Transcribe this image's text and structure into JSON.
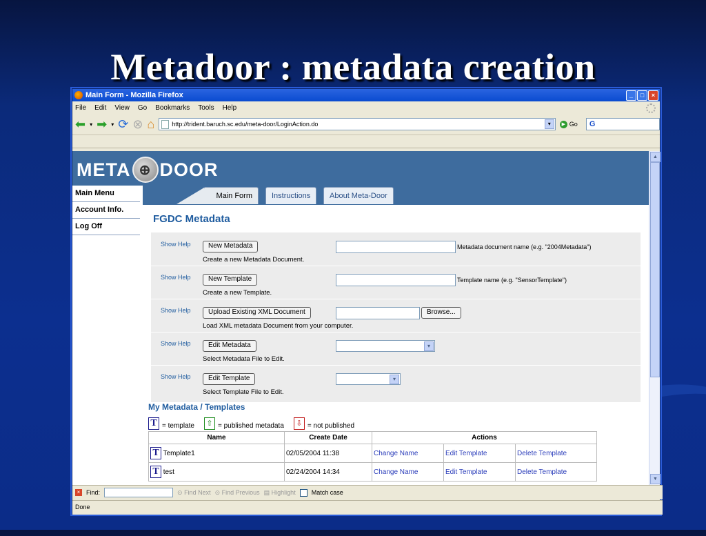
{
  "slide": {
    "title": "Metadoor : metadata creation"
  },
  "window": {
    "title": "Main Form - Mozilla Firefox"
  },
  "menu": [
    "File",
    "Edit",
    "View",
    "Go",
    "Bookmarks",
    "Tools",
    "Help"
  ],
  "toolbar": {
    "url": "http://trident.baruch.sc.edu/meta-door/LoginAction.do",
    "go_label": "Go",
    "search_logo": "G"
  },
  "header": {
    "logo_left": "META",
    "logo_right": "DOOR"
  },
  "sidebar": {
    "items": [
      "Main Menu",
      "Account Info.",
      "Log Off"
    ]
  },
  "tabs": [
    "Main Form",
    "Instructions",
    "About Meta-Door"
  ],
  "form": {
    "title": "FGDC Metadata",
    "show_help": "Show Help",
    "rows": [
      {
        "button": "New Metadata",
        "desc": "Create a new Metadata Document.",
        "hint": "Metadata document name (e.g. \"2004Metadata\")"
      },
      {
        "button": "New Template",
        "desc": "Create a new Template.",
        "hint": "Template name (e.g. \"SensorTemplate\")"
      },
      {
        "button": "Upload Existing XML Document",
        "desc": "Load XML metadata Document from your computer.",
        "browse": "Browse..."
      },
      {
        "button": "Edit Metadata",
        "desc": "Select Metadata File to Edit."
      },
      {
        "button": "Edit Template",
        "desc": "Select Template File to Edit."
      }
    ]
  },
  "my": {
    "title": "My Metadata / Templates",
    "legend": {
      "template": "= template",
      "published": "= published metadata",
      "not_published": "= not published"
    },
    "columns": [
      "Name",
      "Create Date",
      "Actions"
    ],
    "rows": [
      {
        "name": "Template1",
        "date": "02/05/2004 11:38",
        "a1": "Change Name",
        "a2": "Edit Template",
        "a3": "Delete Template"
      },
      {
        "name": "test",
        "date": "02/24/2004 14:34",
        "a1": "Change Name",
        "a2": "Edit Template",
        "a3": "Delete Template"
      }
    ]
  },
  "findbar": {
    "label": "Find:",
    "next": "Find Next",
    "previous": "Find Previous",
    "highlight": "Highlight",
    "match_case": "Match case"
  },
  "status": "Done"
}
